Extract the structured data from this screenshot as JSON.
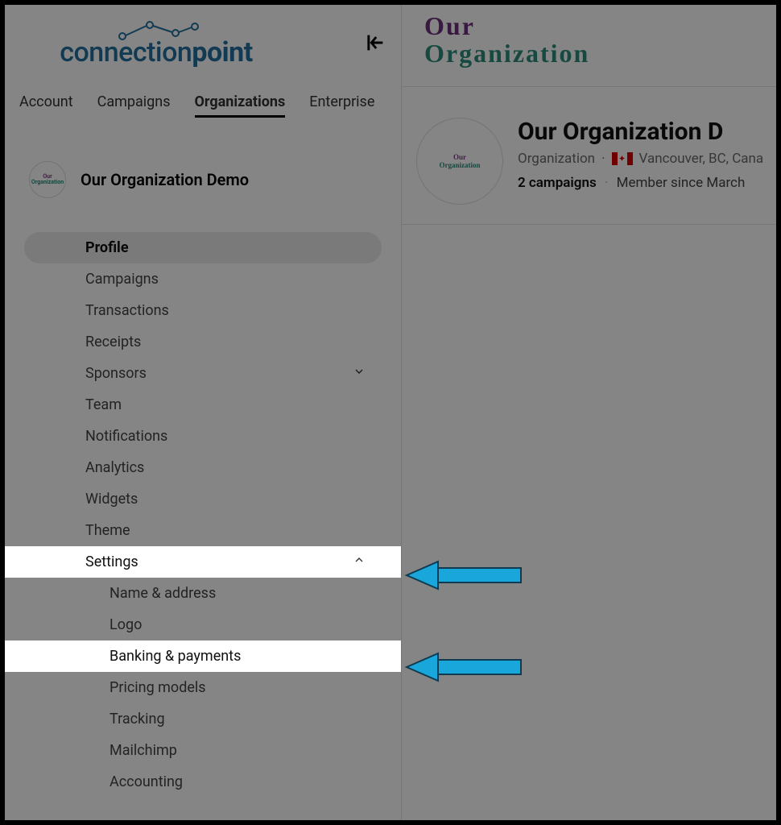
{
  "logo": {
    "part1": "connection",
    "part2": "point"
  },
  "top_tabs": [
    {
      "label": "Account",
      "active": false
    },
    {
      "label": "Campaigns",
      "active": false
    },
    {
      "label": "Organizations",
      "active": true
    },
    {
      "label": "Enterprise",
      "active": false
    }
  ],
  "current_org": {
    "name": "Our Organization Demo",
    "mini_l1": "Our",
    "mini_l2": "Organization"
  },
  "menu": {
    "items": [
      {
        "label": "Profile",
        "type": "item",
        "active": true
      },
      {
        "label": "Campaigns",
        "type": "item"
      },
      {
        "label": "Transactions",
        "type": "item"
      },
      {
        "label": "Receipts",
        "type": "item"
      },
      {
        "label": "Sponsors",
        "type": "expandable",
        "expanded": false
      },
      {
        "label": "Team",
        "type": "item"
      },
      {
        "label": "Notifications",
        "type": "item"
      },
      {
        "label": "Analytics",
        "type": "item"
      },
      {
        "label": "Widgets",
        "type": "item"
      },
      {
        "label": "Theme",
        "type": "item"
      },
      {
        "label": "Settings",
        "type": "expandable",
        "expanded": true,
        "highlight": true
      }
    ],
    "settings_sub": [
      {
        "label": "Name & address"
      },
      {
        "label": "Logo"
      },
      {
        "label": "Banking & payments",
        "highlight": true
      },
      {
        "label": "Pricing models"
      },
      {
        "label": "Tracking"
      },
      {
        "label": "Mailchimp"
      },
      {
        "label": "Accounting"
      }
    ]
  },
  "main": {
    "wordmark_l1": "Our",
    "wordmark_l2": "Organization",
    "heading": "Our Organization D",
    "type_label": "Organization",
    "location": "Vancouver, BC, Cana",
    "campaigns_count": "2 campaigns",
    "member_since": "Member since March"
  }
}
